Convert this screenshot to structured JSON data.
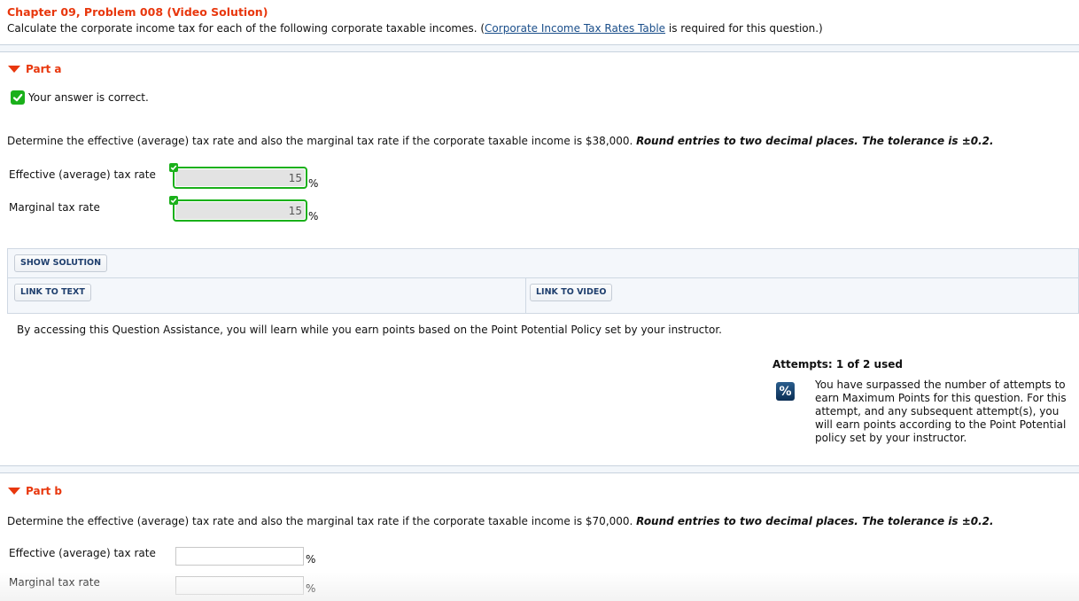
{
  "header": {
    "title": "Chapter 09, Problem 008 (Video Solution)",
    "desc_before": "Calculate the corporate income tax for each of the following corporate taxable incomes. (",
    "link": "Corporate Income Tax Rates Table",
    "desc_after": " is required for this question.)"
  },
  "part_a": {
    "heading": "Part a",
    "status": "Your answer is correct.",
    "question_plain": "Determine the effective (average) tax rate and also the marginal tax rate if the corporate taxable income is $38,000. ",
    "question_emph": "Round entries to two decimal places. The tolerance is ±0.2.",
    "fields": [
      {
        "label": "Effective (average) tax rate",
        "value": "15",
        "unit": "%",
        "correct": true
      },
      {
        "label": "Marginal tax rate",
        "value": "15",
        "unit": "%",
        "correct": true
      }
    ]
  },
  "assistance": {
    "show_solution": "SHOW SOLUTION",
    "link_to_text": "LINK TO TEXT",
    "link_to_video": "LINK TO VIDEO",
    "note": "By accessing this Question Assistance, you will learn while you earn points based on the Point Potential Policy set by your instructor."
  },
  "attempts": {
    "title": "Attempts: 1 of 2 used",
    "icon": "percent-icon",
    "icon_glyph": "%",
    "message": "You have surpassed the number of attempts to earn Maximum Points for this question. For this attempt, and any subsequent attempt(s), you will earn points according to the Point Potential policy set by your instructor."
  },
  "part_b": {
    "heading": "Part b",
    "question_plain": "Determine the effective (average) tax rate and also the marginal tax rate if the corporate taxable income is $70,000. ",
    "question_emph": "Round entries to two decimal places. The tolerance is ±0.2.",
    "fields": [
      {
        "label": "Effective (average) tax rate",
        "value": "",
        "unit": "%"
      },
      {
        "label": "Marginal tax rate",
        "value": "",
        "unit": "%"
      }
    ]
  },
  "colors": {
    "accent": "#e8370d",
    "correct": "#1ab01a",
    "link": "#1a4e8a",
    "button_text": "#1f3f6e"
  }
}
